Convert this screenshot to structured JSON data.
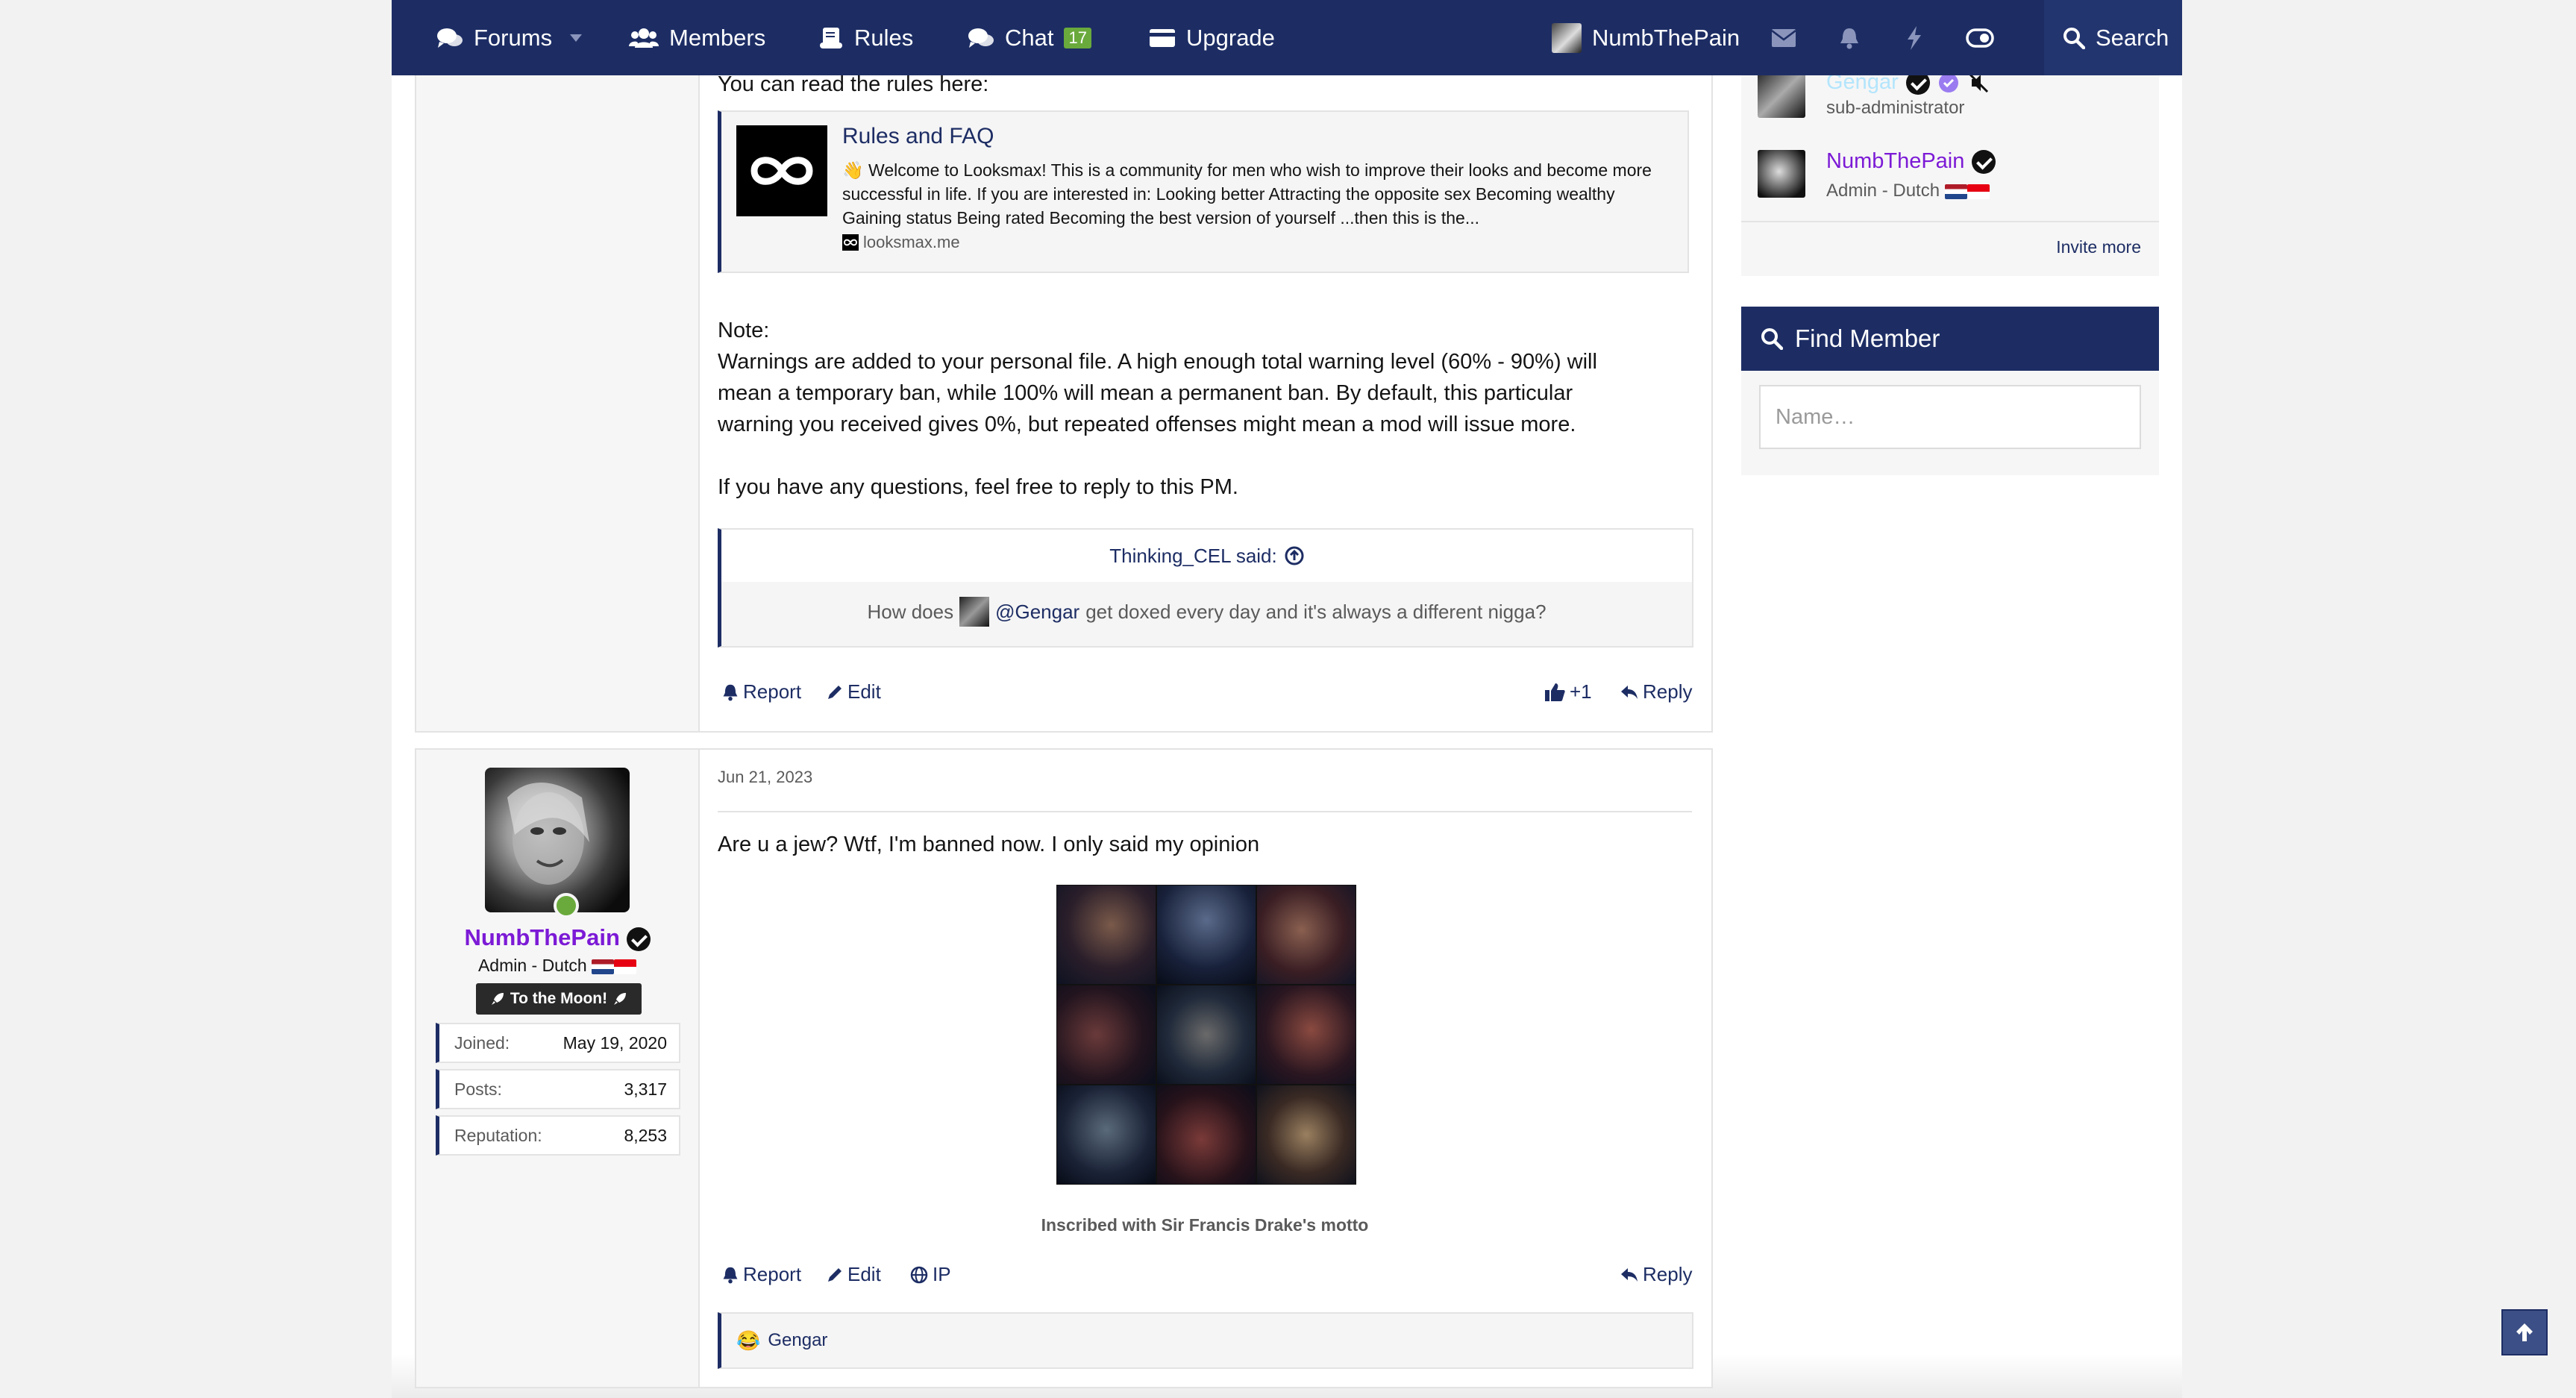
{
  "nav": {
    "forums": "Forums",
    "members": "Members",
    "rules": "Rules",
    "chat": "Chat",
    "chat_badge": "17",
    "upgrade": "Upgrade",
    "username": "NumbThePain",
    "search": "Search"
  },
  "post1": {
    "rules_intro": "You can read the rules here:",
    "embed": {
      "title": "Rules and FAQ",
      "emoji": "👋",
      "text": "Welcome to Looksmax! This is a community for men who wish to improve their looks and become more successful in life. If you are interested in: Looking better Attracting the opposite sex Becoming wealthy Gaining status Being rated Becoming the best version of yourself ...then this is the...",
      "domain": "looksmax.me"
    },
    "note_label": "Note:",
    "note_line1": "Warnings are added to your personal file. A high enough total warning level (60% - 90%) will",
    "note_line2": "mean a temporary ban, while 100% will mean a permanent ban. By default, this particular",
    "note_line3": "warning you received gives 0%, but repeated offenses might mean a mod will issue more.",
    "questions": "If you have any questions, feel free to reply to this PM.",
    "quote": {
      "author": "Thinking_CEL said:",
      "text_before": "How does",
      "mention": "@Gengar",
      "text_after": "get doxed every day and it's always a different nigga?"
    },
    "actions": {
      "report": "Report",
      "edit": "Edit",
      "like_count": "+1",
      "reply": "Reply"
    }
  },
  "post2": {
    "user": {
      "name": "NumbThePain",
      "title": "Admin - Dutch",
      "banner": "To the Moon!",
      "stats": [
        {
          "label": "Joined:",
          "value": "May 19, 2020"
        },
        {
          "label": "Posts:",
          "value": "3,317"
        },
        {
          "label": "Reputation:",
          "value": "8,253"
        }
      ]
    },
    "date": "Jun 21, 2023",
    "text": "Are u a jew? Wtf, I'm banned now. I only said my opinion",
    "caption": "Inscribed with Sir Francis Drake's motto",
    "actions": {
      "report": "Report",
      "edit": "Edit",
      "ip": "IP",
      "reply": "Reply"
    },
    "reaction_user": "Gengar"
  },
  "sidebar": {
    "staff": [
      {
        "name": "Gengar",
        "role": "sub-administrator"
      },
      {
        "name": "NumbThePain",
        "role": "Admin - Dutch"
      }
    ],
    "invite_more": "Invite more",
    "find_member": {
      "title": "Find Member",
      "placeholder": "Name…"
    }
  },
  "colors": {
    "nav_bg": "#1d2d64",
    "accent": "#1d2d64",
    "username": "#7c1ad6",
    "online": "#6aaa3c"
  }
}
